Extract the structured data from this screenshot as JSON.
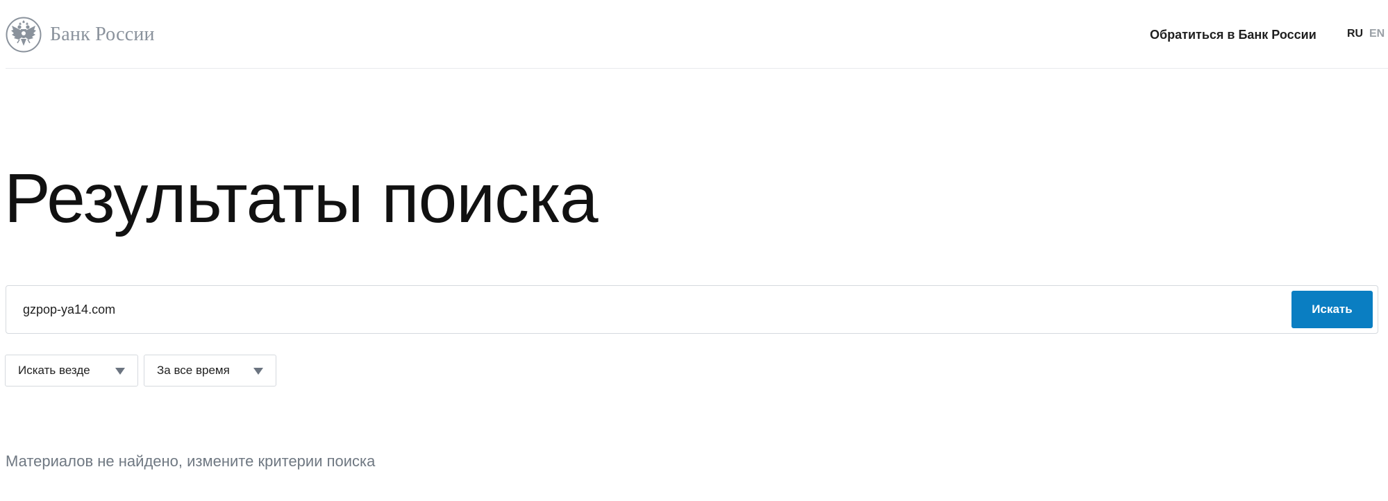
{
  "header": {
    "logo_text": "Банк России",
    "contact_link": "Обратиться в Банк России",
    "languages": [
      {
        "code": "RU",
        "active": true
      },
      {
        "code": "EN",
        "active": false
      }
    ]
  },
  "main": {
    "title": "Результаты поиска",
    "search": {
      "value": "gzpop-ya14.com",
      "button_label": "Искать"
    },
    "filters": [
      {
        "label": "Искать везде"
      },
      {
        "label": "За все время"
      }
    ],
    "no_results_message": "Материалов не найдено, измените критерии поиска"
  },
  "icons": {
    "logo": "double-headed-eagle-emblem",
    "dropdown": "triangle-down-icon"
  },
  "colors": {
    "accent": "#0a7ec2",
    "text": "#1f1f1f",
    "muted": "#6f7882",
    "logo": "#8a929c"
  }
}
